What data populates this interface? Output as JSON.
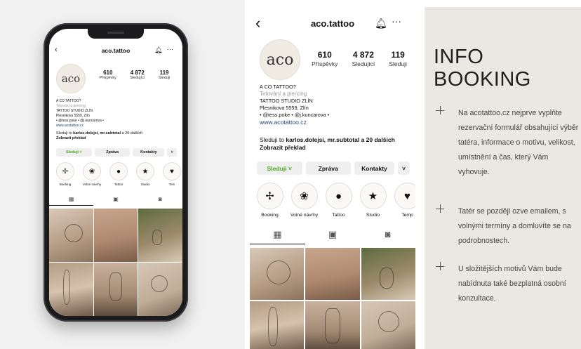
{
  "profile": {
    "username": "aco.tattoo",
    "avatar_text": "aco",
    "stats": [
      {
        "value": "610",
        "label": "Příspěvky"
      },
      {
        "value": "4 872",
        "label": "Sledující"
      },
      {
        "value": "119",
        "label": "Sleduji"
      }
    ],
    "bio": {
      "name": "A CO TATTOO?",
      "category": "Tetování a piercing",
      "studio": "TATTOO STUDIO ZLÍN",
      "address": "Plesnikova 5559, Zlín",
      "mentions": "• @tess.poke • @j.kuncarova •",
      "website": "www.acotattoo.cz"
    },
    "followed_by": {
      "prefix": "Sleduji to ",
      "names": "karlos.dolejsi, mr.subtotal",
      "suffix": " a 20 dalších",
      "translate": "Zobrazit překlad"
    },
    "buttons": {
      "follow": "Sleduji ˅",
      "message": "Zpráva",
      "contacts": "Kontakty",
      "more": "˅"
    },
    "highlights": [
      {
        "label": "Booking",
        "icon": "sparkle-icon"
      },
      {
        "label": "Volné návrhy",
        "icon": "rose-icon"
      },
      {
        "label": "Tattoo",
        "icon": "dot-icon"
      },
      {
        "label": "Studio",
        "icon": "star-icon"
      },
      {
        "label": "Temp",
        "icon": "heart-icon"
      }
    ],
    "mini_highlights": [
      {
        "label": "Booking"
      },
      {
        "label": "Volné návrhy"
      },
      {
        "label": "Tattoo"
      },
      {
        "label": "Studio"
      },
      {
        "label": "Tem"
      }
    ],
    "tabs": [
      "grid-icon",
      "reels-icon",
      "tagged-icon"
    ]
  },
  "info": {
    "title_line1": "INFO",
    "title_line2": "BOOKING",
    "bullets": [
      "Na acotattoo.cz nejprve vyplňte rezervační formulář obsahující výběr tatéra, informace o motivu, velikost, umístnění a čas, který Vám vyhovuje.",
      "Tatér se později ozve emailem, s volnými termíny a domluvíte se na podrobnostech.",
      "U složitějších motivů Vám bude nabídnuta také bezplatná osobní konzultace."
    ]
  },
  "colors": {
    "follow_green": "#4aa51a",
    "link_blue": "#1d3f73",
    "info_bg": "#ebe7e2"
  }
}
